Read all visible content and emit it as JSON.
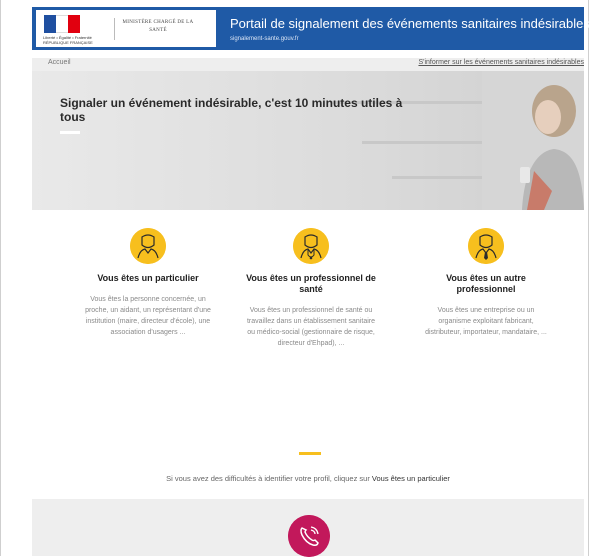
{
  "header": {
    "flag_caption": "Liberté • Égalité • Fraternité RÉPUBLIQUE FRANÇAISE",
    "ministry": "MINISTÈRE CHARGÉ DE LA SANTÉ",
    "title": "Portail de signalement des événements sanitaires indésirables",
    "subtitle": "signalement-sante.gouv.fr",
    "power_icon": "power-icon",
    "flag_colors": [
      "#1f4fa0",
      "#ffffff",
      "#e1000f"
    ]
  },
  "breadcrumb": {
    "home": "Accueil",
    "inform_link": "S'informer sur les événements sanitaires indésirables"
  },
  "hero": {
    "title": "Signaler un événement indésirable, c'est 10 minutes utiles à tous"
  },
  "profiles": [
    {
      "icon": "person-icon",
      "title": "Vous êtes un particulier",
      "description": "Vous êtes la personne concernée, un proche, un aidant, un représentant d'une institution (maire, directeur d'école), une association d'usagers ..."
    },
    {
      "icon": "doctor-icon",
      "title": "Vous êtes un professionnel de santé",
      "description": "Vous êtes un professionnel de santé ou travaillez dans un établissement sanitaire ou médico-social (gestionnaire de risque, directeur d'Ehpad), ..."
    },
    {
      "icon": "businessman-icon",
      "title": "Vous êtes un autre professionnel",
      "description": "Vous êtes une entreprise ou un organisme exploitant fabricant, distributeur, importateur, mandataire, ..."
    }
  ],
  "help": {
    "text": "Si vous avez des difficultés à identifier votre profil, cliquez sur ",
    "link": "Vous êtes un particulier"
  },
  "footer": {
    "icon": "phone-icon",
    "accent": "#c2185b"
  },
  "colors": {
    "header_blue": "#1f5aa6",
    "accent_yellow": "#f7bf1e"
  }
}
